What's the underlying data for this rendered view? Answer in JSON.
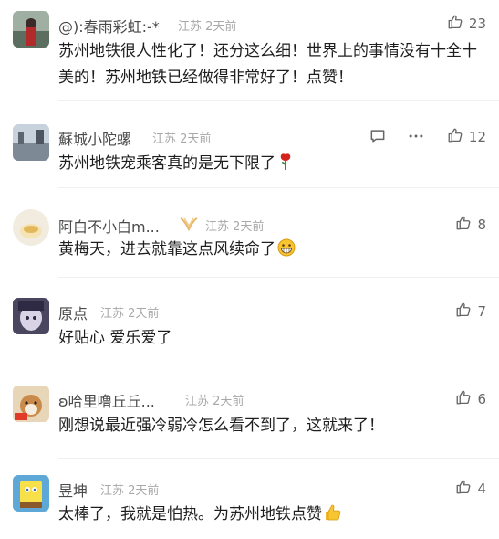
{
  "comments": [
    {
      "name": "@):春雨彩虹:-*",
      "location": "江苏",
      "time": "2天前",
      "text": "苏州地铁很人性化了！还分这么细！世界上的事情没有十全十美的！苏州地铁已经做得非常好了！点赞！",
      "likes": "23"
    },
    {
      "name": "蘇城小陀螺",
      "location": "江苏",
      "time": "2天前",
      "text": "苏州地铁宠乘客真的是无下限了",
      "likes": "12"
    },
    {
      "name": "阿白不小白m...",
      "location": "江苏",
      "time": "2天前",
      "text": "黄梅天，进去就靠这点风续命了",
      "likes": "8"
    },
    {
      "name": "原点",
      "location": "江苏",
      "time": "2天前",
      "text": "好贴心 爱乐爱了",
      "likes": "7"
    },
    {
      "name": "ʚ哈里噜丘丘...",
      "location": "江苏",
      "time": "2天前",
      "text": "刚想说最近强冷弱冷怎么看不到了，这就来了！",
      "likes": "6"
    },
    {
      "name": "昱坤",
      "location": "江苏",
      "time": "2天前",
      "text": "太棒了，我就是怕热。为苏州地铁点赞",
      "likes": "4"
    }
  ],
  "colors": {
    "accent": "#4a4a4a",
    "meta": "#a8a8a8",
    "text": "#1e1e1e",
    "like": "#666666"
  },
  "icons": {
    "like": "thumbs-up-icon",
    "reply": "comment-icon",
    "more": "more-icon",
    "rose": "rose-emoji",
    "grin": "grin-emoji",
    "thumb": "thumbs-up-emoji"
  }
}
